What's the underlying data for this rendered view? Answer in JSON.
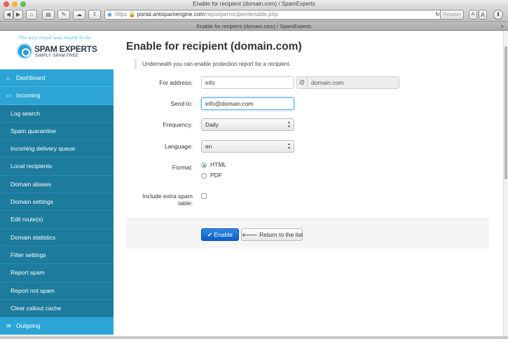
{
  "window": {
    "title": "Enable for recipient (domain.com) / SpamExperts"
  },
  "toolbar": {
    "url_prefix": "https",
    "url_host": "portal.antispamengine.com",
    "url_path": "/reportperrecipientenable.php",
    "reader_label": "Reader",
    "text_small": "A",
    "text_large": "A"
  },
  "tab": {
    "label": "Enable for recipient (domain.com) / SpamExperts"
  },
  "logo": {
    "tagline": "The way email was meant to be.",
    "name": "SPAM EXPERTS",
    "subtitle": "SIMPLY SPAM FREE"
  },
  "sidebar": {
    "items": [
      {
        "label": "Dashboard",
        "icon": "home-icon",
        "top": true
      },
      {
        "label": "Incoming",
        "icon": "inbox-icon",
        "top": true
      },
      {
        "label": "Log search"
      },
      {
        "label": "Spam quarantine"
      },
      {
        "label": "Incoming delivery queue"
      },
      {
        "label": "Local recipients"
      },
      {
        "label": "Domain aliases"
      },
      {
        "label": "Domain settings"
      },
      {
        "label": "Edit route(s)"
      },
      {
        "label": "Domain statistics"
      },
      {
        "label": "Filter settings"
      },
      {
        "label": "Report spam"
      },
      {
        "label": "Report not spam"
      },
      {
        "label": "Clear callout cache"
      },
      {
        "label": "Outgoing",
        "icon": "envelope-icon",
        "top": true
      }
    ]
  },
  "main": {
    "title": "Enable for recipient (domain.com)",
    "note": "Underneath you can enable protection report for a recipient.",
    "form": {
      "for_address_label": "For address:",
      "for_address_value": "info",
      "at_sign": "@",
      "domain_value": "domain.com",
      "send_to_label": "Send to:",
      "send_to_value": "info@domain.com",
      "frequency_label": "Frequency:",
      "frequency_value": "Daily",
      "language_label": "Language:",
      "language_value": "en",
      "format_label": "Format:",
      "format_options": [
        "HTML",
        "PDF"
      ],
      "format_selected": "HTML",
      "extra_label_line1": "Include extra spam",
      "extra_label_line2": "table:",
      "extra_checked": false
    },
    "buttons": {
      "enable": "Enable",
      "return": "Return to the list"
    }
  },
  "colors": {
    "sidebar_top": "#2ca5d6",
    "sidebar_sub": "#1d7b9d",
    "primary_button": "#1a6fd6"
  }
}
